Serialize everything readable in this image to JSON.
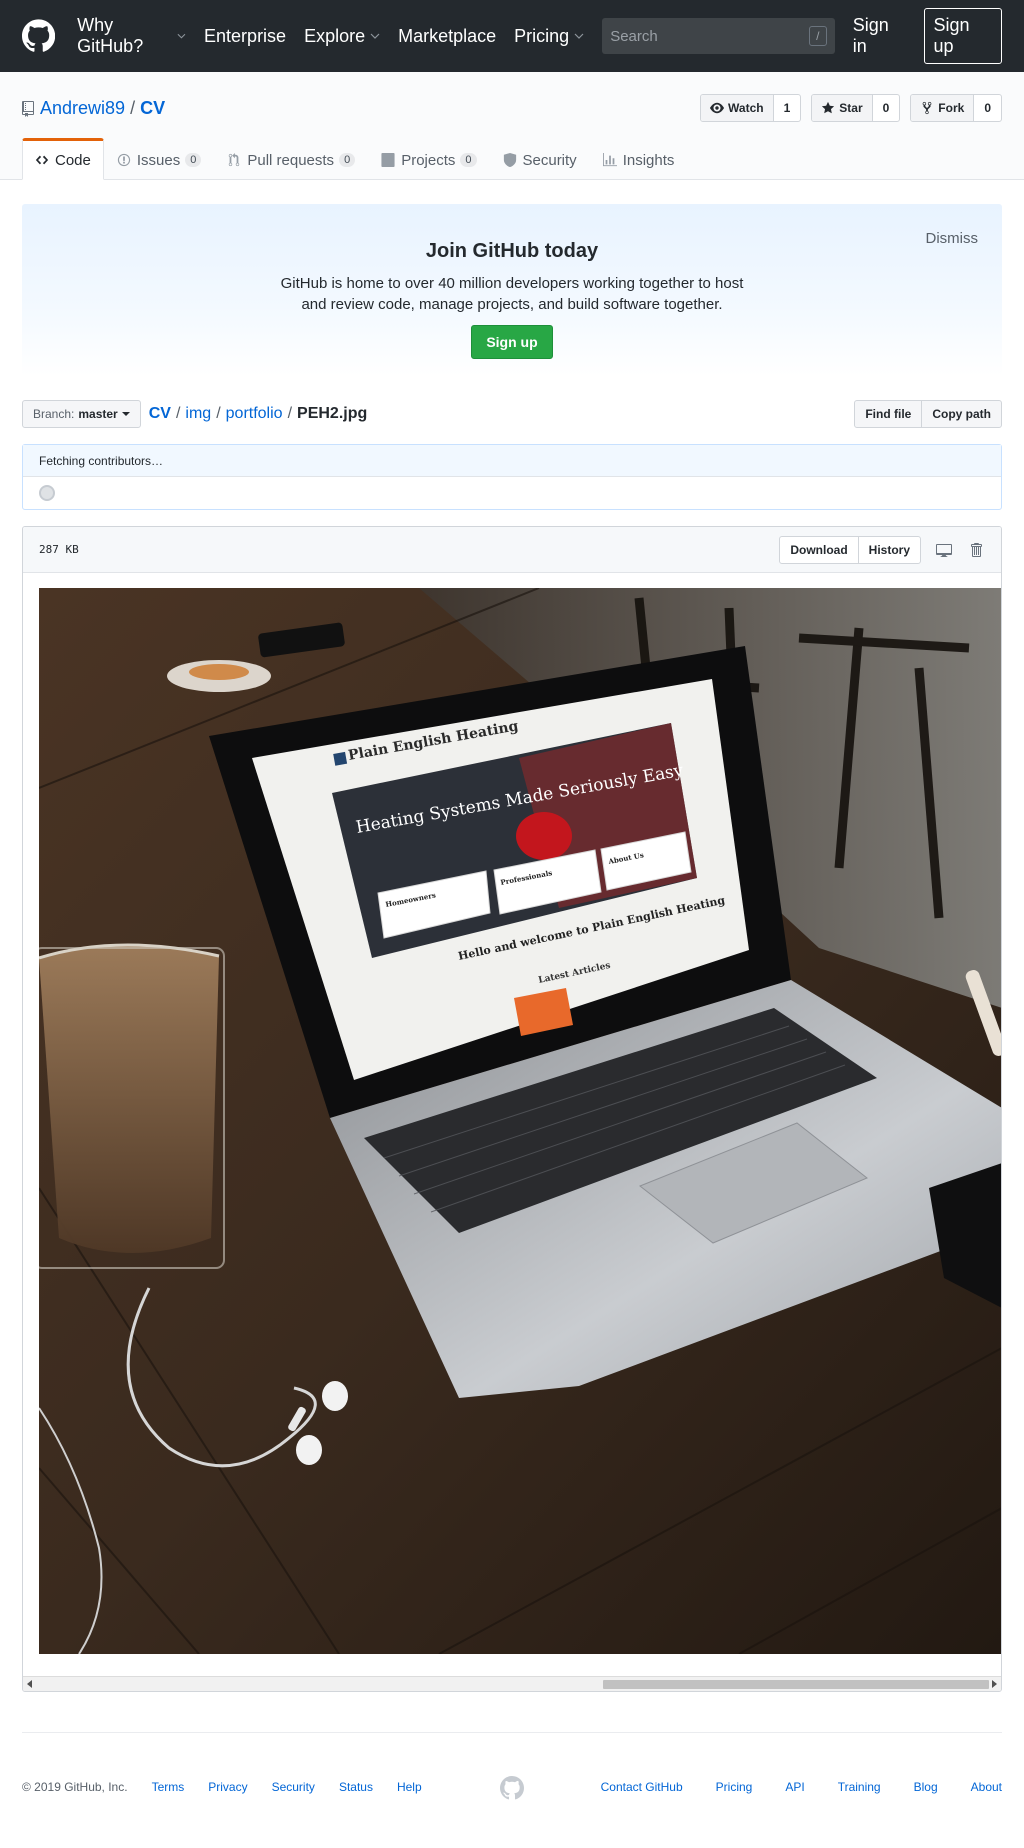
{
  "header": {
    "nav": [
      {
        "label": "Why GitHub?",
        "caret": true
      },
      {
        "label": "Enterprise",
        "caret": false
      },
      {
        "label": "Explore",
        "caret": true
      },
      {
        "label": "Marketplace",
        "caret": false
      },
      {
        "label": "Pricing",
        "caret": true
      }
    ],
    "search_placeholder": "Search",
    "search_key": "/",
    "signin": "Sign in",
    "signup": "Sign up"
  },
  "repo": {
    "owner": "Andrewi89",
    "separator": "/",
    "name": "CV",
    "watch": {
      "label": "Watch",
      "count": "1"
    },
    "star": {
      "label": "Star",
      "count": "0"
    },
    "fork": {
      "label": "Fork",
      "count": "0"
    }
  },
  "tabs": [
    {
      "label": "Code",
      "counter": null
    },
    {
      "label": "Issues",
      "counter": "0"
    },
    {
      "label": "Pull requests",
      "counter": "0"
    },
    {
      "label": "Projects",
      "counter": "0"
    },
    {
      "label": "Security",
      "counter": null
    },
    {
      "label": "Insights",
      "counter": null
    }
  ],
  "prompt": {
    "title": "Join GitHub today",
    "body": "GitHub is home to over 40 million developers working together to host and review code, manage projects, and build software together.",
    "button": "Sign up",
    "dismiss": "Dismiss"
  },
  "filenav": {
    "branch_label": "Branch:",
    "branch": "master",
    "path": [
      "CV",
      "img",
      "portfolio"
    ],
    "file": "PEH2.jpg",
    "find_file": "Find file",
    "copy_path": "Copy path"
  },
  "commit": {
    "status": "Fetching contributors…"
  },
  "file": {
    "size": "287 KB",
    "download": "Download",
    "history": "History"
  },
  "image_text": {
    "brand": "Plain English Heating",
    "hero": "Heating Systems Made Seriously Easy",
    "welcome": "Hello and welcome to Plain English Heating",
    "latest": "Latest Articles",
    "cards": [
      "Homeowners",
      "Professionals",
      "About Us"
    ]
  },
  "footer": {
    "copyright": "© 2019 GitHub, Inc.",
    "left_links": [
      "Terms",
      "Privacy",
      "Security",
      "Status",
      "Help"
    ],
    "right_links": [
      "Contact GitHub",
      "Pricing",
      "API",
      "Training",
      "Blog",
      "About"
    ]
  },
  "colors": {
    "header_bg": "#24292e",
    "link": "#0366d6",
    "tab_accent": "#e36209",
    "green": "#28a745"
  }
}
